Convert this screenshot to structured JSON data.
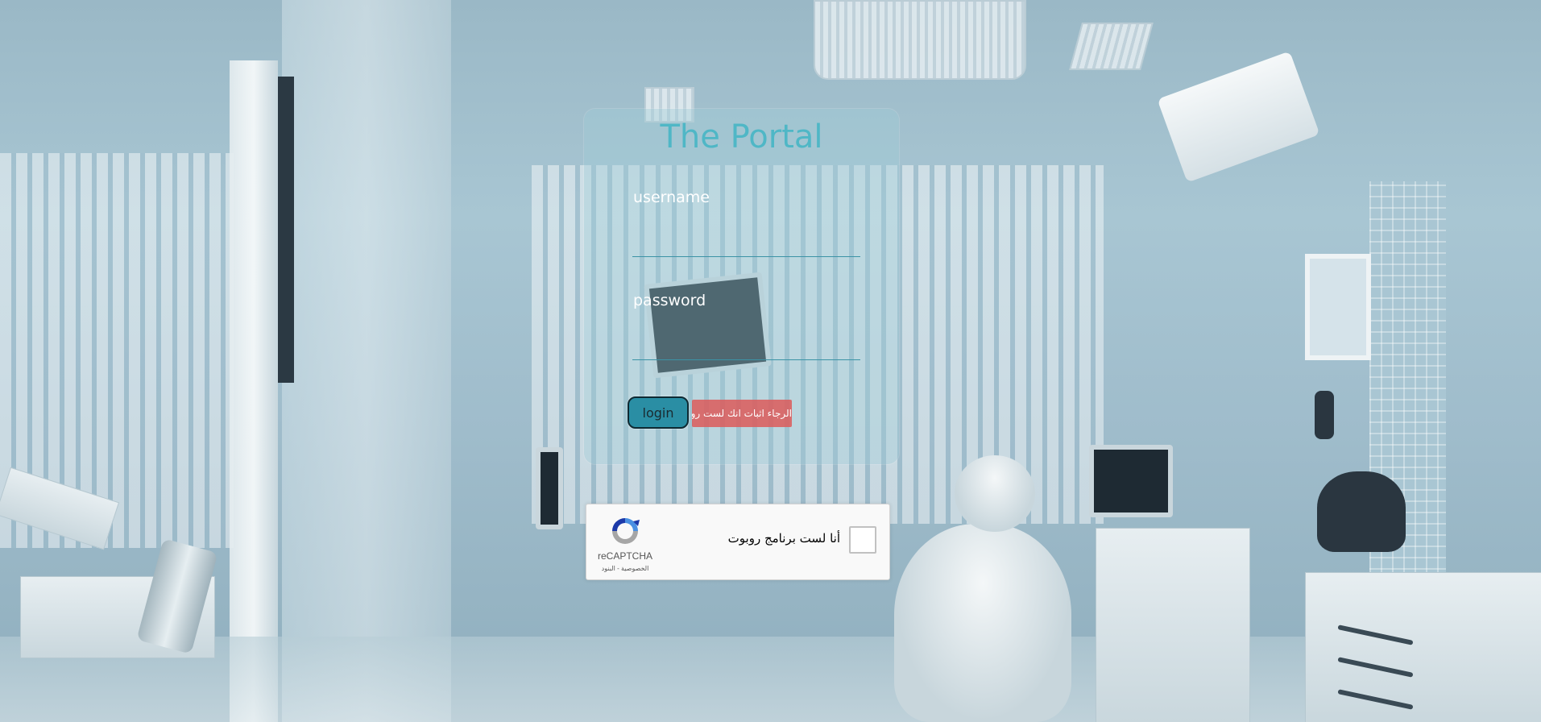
{
  "login_card": {
    "title": "The Portal",
    "username_label": "username",
    "password_label": "password",
    "login_label": "login",
    "error_message": "الرجاء اثبات انك لست روبوت",
    "accent_color": "#4fb7c6",
    "error_color": "#dc5a5a"
  },
  "recaptcha": {
    "checkbox_label": "أنا لست برنامج روبوت",
    "brand": "reCAPTCHA",
    "links": "الخصوصية - البنود",
    "logo_icon": "recaptcha-logo-icon"
  }
}
